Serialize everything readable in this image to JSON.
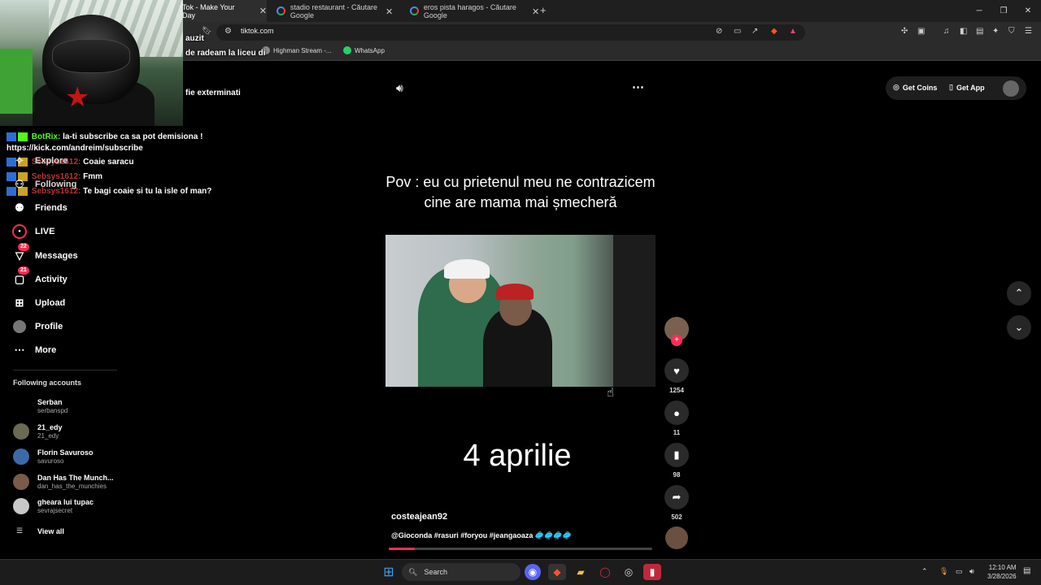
{
  "browser": {
    "tabs": [
      {
        "label": "Tok - Make Your Day",
        "close": "✕"
      },
      {
        "label": "stadio restaurant - Căutare Google",
        "close": "✕"
      },
      {
        "label": "eros pista haragos - Căutare Google",
        "close": "✕"
      }
    ],
    "new_tab": "+",
    "url": "tiktok.com",
    "bookmarks": [
      "Highman Stream -...",
      "WhatsApp"
    ]
  },
  "overlay": {
    "texts": [
      "auzit",
      "de radeam la liceu di",
      "fie exterminati"
    ],
    "chat": [
      {
        "user": "BotRix:",
        "text": "la-ti subscribe ca sa pot demisiona !"
      },
      {
        "user": "",
        "text": "https://kick.com/andreim/subscribe"
      },
      {
        "user": "Sebsys1612:",
        "text": "Coaie saracu"
      },
      {
        "user": "Sebsys1612:",
        "text": "Fmm"
      },
      {
        "user": "Sebsys1612:",
        "text": "Te bagi coaie si tu la isle of man?"
      }
    ]
  },
  "sidebar": {
    "items": [
      {
        "label": "Explore",
        "icon": "compass-icon"
      },
      {
        "label": "Following",
        "icon": "following-icon"
      },
      {
        "label": "Friends",
        "icon": "friends-icon"
      },
      {
        "label": "LIVE",
        "icon": "live-icon"
      },
      {
        "label": "Messages",
        "icon": "messages-icon",
        "count": "22"
      },
      {
        "label": "Activity",
        "icon": "activity-icon",
        "count": "21"
      },
      {
        "label": "Upload",
        "icon": "upload-icon"
      },
      {
        "label": "Profile",
        "icon": "profile-icon"
      },
      {
        "label": "More",
        "icon": "more-icon"
      }
    ],
    "following_title": "Following accounts",
    "accounts": [
      {
        "name": "Serban",
        "handle": "serbanspd"
      },
      {
        "name": "21_edy",
        "handle": "21_edy"
      },
      {
        "name": "Florin Savuroso",
        "handle": "savuroso"
      },
      {
        "name": "Dan Has The Munch...",
        "handle": "dan_has_the_munchies"
      },
      {
        "name": "gheara lui tupac",
        "handle": "sevrajsecret"
      }
    ],
    "view_all": "View all"
  },
  "video": {
    "overlay_text": "Pov : eu cu prietenul meu ne contrazicem cine are mama mai șmecheră",
    "date_text": "4 aprilie",
    "author": "costeajean92",
    "caption": "@Gioconda #rasuri #foryou #jeangaoaza 🥏🥏🥏🥏",
    "progress": 0.1
  },
  "actions": {
    "likes": "1254",
    "comments": "11",
    "saves": "98",
    "shares": "502"
  },
  "header": {
    "get_coins": "Get Coins",
    "get_app": "Get App"
  },
  "taskbar": {
    "search": "Search",
    "time": "12:10 AM",
    "date": "3/28/2026"
  },
  "colors": {
    "accent": "#fe2c55",
    "background": "#000000"
  }
}
